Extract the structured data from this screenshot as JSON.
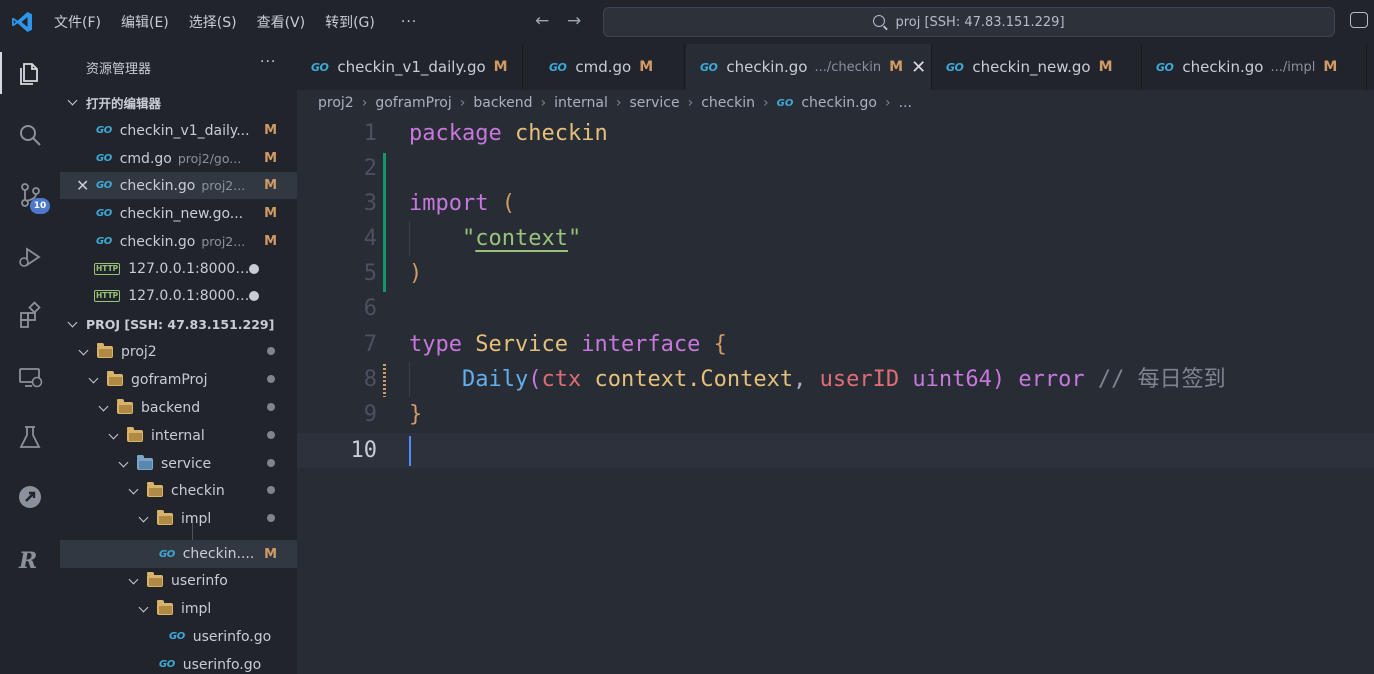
{
  "menu": [
    "文件(F)",
    "编辑(E)",
    "选择(S)",
    "查看(V)",
    "转到(G)",
    "···"
  ],
  "search": {
    "text": "proj [SSH: 47.83.151.229]"
  },
  "activity": {
    "scm_badge": "10"
  },
  "sidebar": {
    "title": "资源管理器",
    "more": "···",
    "open_editors_title": "打开的编辑器",
    "open_editors": [
      {
        "name": "checkin_v1_daily...",
        "path": "",
        "status": "M"
      },
      {
        "name": "cmd.go",
        "path": "proj2/go...",
        "status": "M"
      },
      {
        "name": "checkin.go",
        "path": "proj2...",
        "status": "M"
      },
      {
        "name": "checkin_new.go...",
        "path": "",
        "status": "M"
      },
      {
        "name": "checkin.go",
        "path": "proj2...",
        "status": "M"
      },
      {
        "name": "127.0.0.1:8000/...",
        "path": "",
        "status": ""
      },
      {
        "name": "127.0.0.1:8000/...",
        "path": "",
        "status": ""
      }
    ],
    "project_title": "PROJ [SSH: 47.83.151.229]",
    "tree": [
      {
        "name": "proj2"
      },
      {
        "name": "goframProj"
      },
      {
        "name": "backend"
      },
      {
        "name": "internal"
      },
      {
        "name": "service"
      },
      {
        "name": "checkin"
      },
      {
        "name": "impl"
      },
      {
        "name": "checkin....",
        "status": "M"
      },
      {
        "name": "userinfo"
      },
      {
        "name": "impl"
      },
      {
        "name": "userinfo.go"
      },
      {
        "name": "userinfo.go"
      }
    ]
  },
  "tabs": [
    {
      "label": "checkin_v1_daily.go",
      "desc": "",
      "status": "M"
    },
    {
      "label": "cmd.go",
      "desc": "",
      "status": "M"
    },
    {
      "label": "checkin.go",
      "desc": ".../checkin",
      "status": "M"
    },
    {
      "label": "checkin_new.go",
      "desc": "",
      "status": "M"
    },
    {
      "label": "checkin.go",
      "desc": ".../impl",
      "status": "M"
    }
  ],
  "go_icon": "GO",
  "breadcrumb": [
    "proj2",
    "goframProj",
    "backend",
    "internal",
    "service",
    "checkin",
    "checkin.go",
    "..."
  ],
  "code": {
    "line_numbers": [
      "1",
      "2",
      "3",
      "4",
      "5",
      "6",
      "7",
      "8",
      "9",
      "10"
    ],
    "l1": {
      "kw": "package",
      "name": "checkin"
    },
    "l3": {
      "kw": "import",
      "paren": "("
    },
    "l4": {
      "q1": "\"",
      "str": "context",
      "q2": "\""
    },
    "l5": {
      "paren": ")"
    },
    "l7": {
      "kw": "type",
      "name": "Service",
      "kw2": "interface",
      "brace": "{"
    },
    "l8": {
      "fn": "Daily",
      "open": "(",
      "p1": "ctx",
      "t1": "context.Context",
      "comma": ", ",
      "p2": "userID",
      "t2": "uint64",
      "close": ")",
      "ret": "error",
      "comment": "// 每日签到"
    },
    "l9": {
      "brace": "}"
    }
  },
  "colors": {
    "keyword": "#c678dd",
    "type": "#e5c07b",
    "string": "#98c379",
    "func": "#61afef",
    "param": "#e06c75",
    "comment": "#7f848e",
    "modified": "#d19a66",
    "go": "#3ea9d8"
  }
}
